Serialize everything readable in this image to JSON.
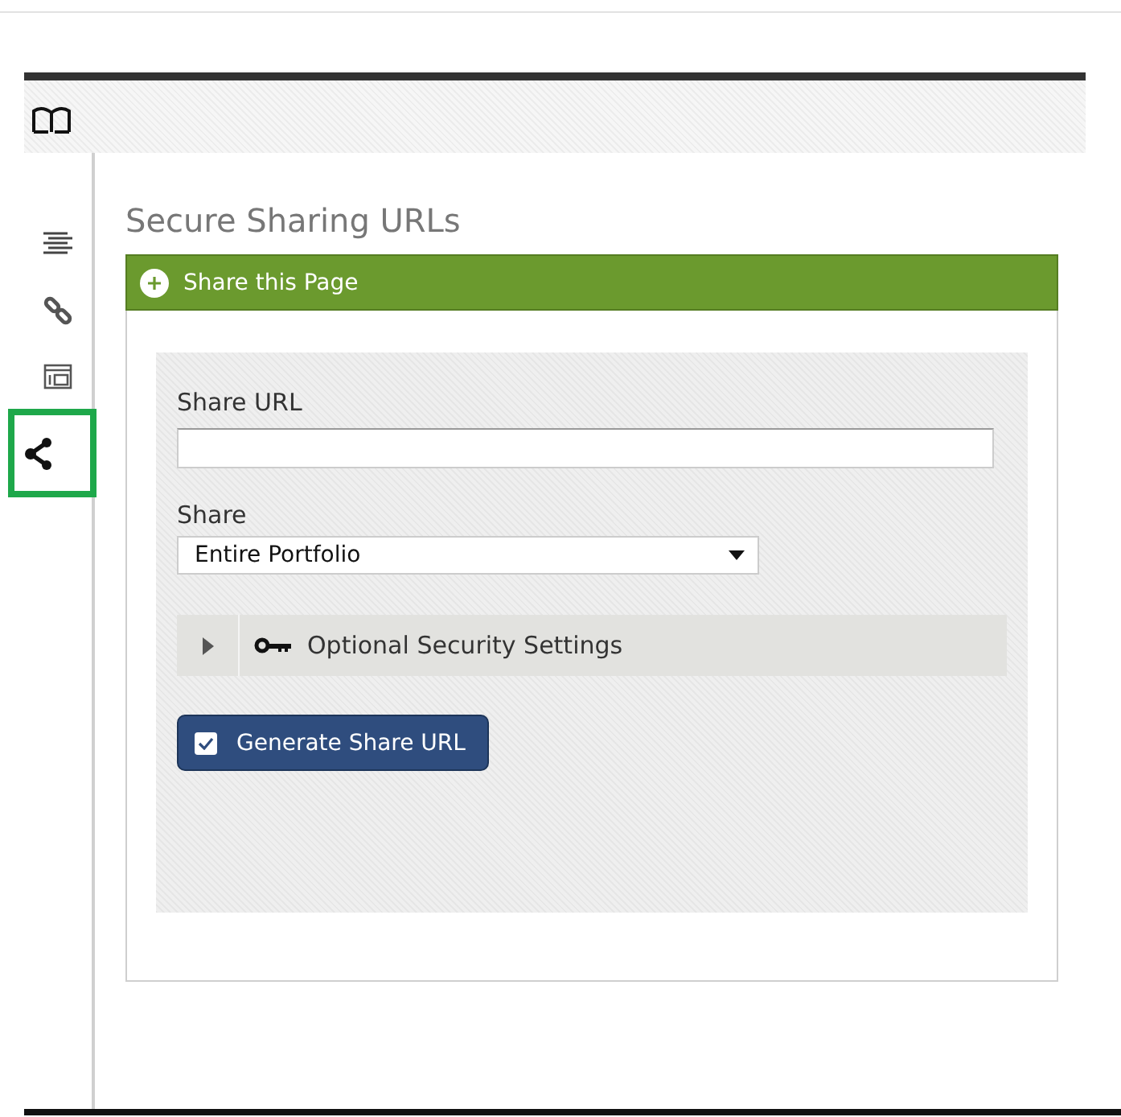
{
  "sidebar": {
    "items": [
      {
        "kind": "list",
        "selected": false
      },
      {
        "kind": "link",
        "selected": false
      },
      {
        "kind": "layout",
        "selected": false
      },
      {
        "kind": "share",
        "selected": true
      }
    ]
  },
  "title": "Secure Sharing URLs",
  "section": {
    "title": "Share this Page"
  },
  "form": {
    "url_label": "Share URL",
    "share_label": "Share",
    "share_value": "Entire Portfolio",
    "security": {
      "label": "Optional Security Settings",
      "expanded": false
    },
    "button": {
      "label": "Generate Share URL",
      "checked": true
    }
  }
}
